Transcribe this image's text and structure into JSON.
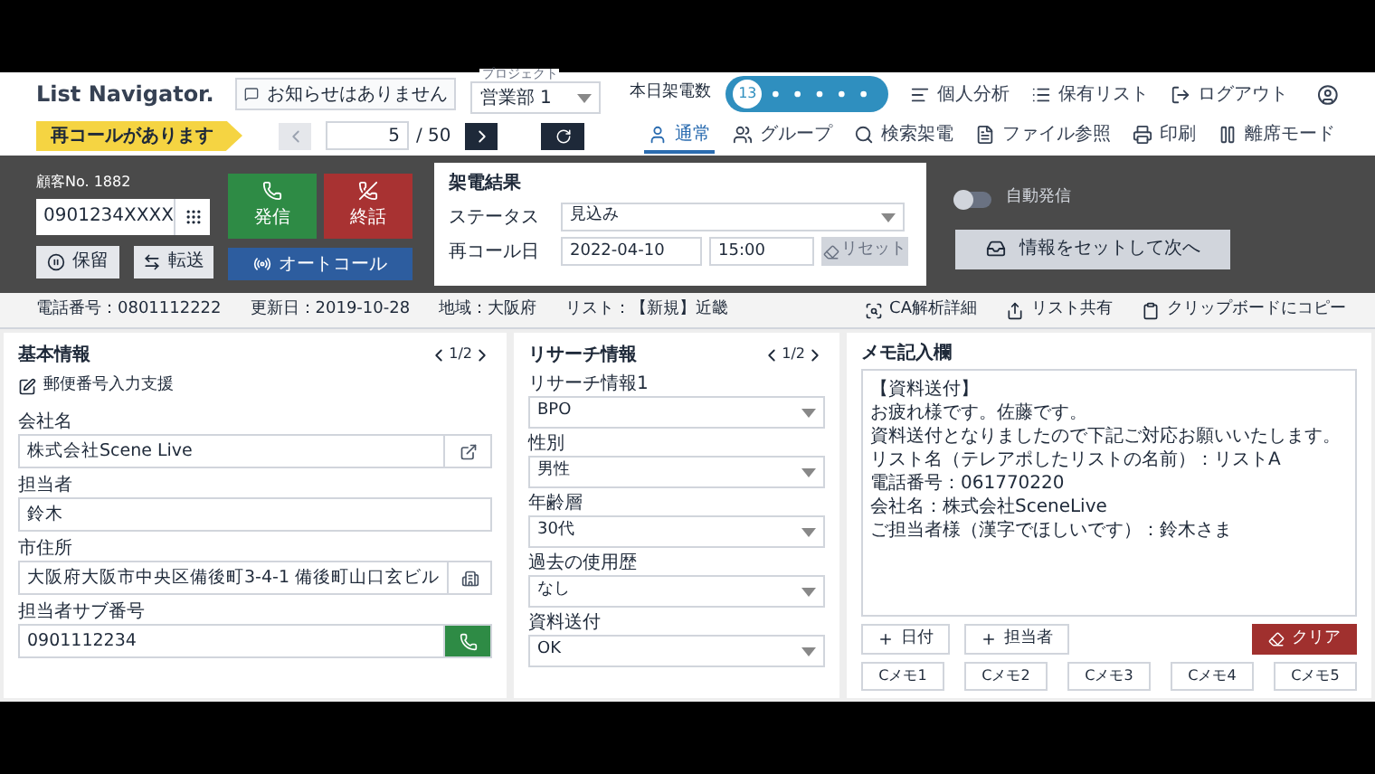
{
  "header": {
    "logo": "List Navigator.",
    "notice": "お知らせはありません",
    "project": {
      "label": "プロジェクト",
      "value": "営業部 1"
    },
    "call_count": {
      "label": "本日架電数",
      "count": "13"
    },
    "links": [
      {
        "label": "個人分析",
        "kind": "analysis"
      },
      {
        "label": "保有リスト",
        "kind": "list"
      },
      {
        "label": "ログアウト",
        "kind": "logout"
      }
    ]
  },
  "recall_notice": "再コールがあります",
  "pager": {
    "current": "5",
    "total": "/ 50",
    "prev_disabled": true,
    "next_disabled": false
  },
  "modes": [
    {
      "label": "通常",
      "kind": "user",
      "selected": true
    },
    {
      "label": "グループ",
      "kind": "group",
      "selected": false
    },
    {
      "label": "検索架電",
      "kind": "search",
      "selected": false
    },
    {
      "label": "ファイル参照",
      "kind": "file",
      "selected": false
    },
    {
      "label": "印刷",
      "kind": "print",
      "selected": false
    },
    {
      "label": "離席モード",
      "kind": "pause",
      "selected": false
    }
  ],
  "call_panel": {
    "customer_no": "顧客No. 1882",
    "phone": "0901234XXXX",
    "dial": "発信",
    "hangup": "終話",
    "hold": "保留",
    "transfer": "転送",
    "autocall": "オートコール"
  },
  "result": {
    "title": "架電結果",
    "status_label": "ステータス",
    "status": "見込み",
    "recall_label": "再コール日",
    "date": "2022-04-10",
    "time": "15:00",
    "reset": "リセット",
    "reset_disabled": true
  },
  "auto_dial": {
    "label": "自動発信",
    "on": false
  },
  "next_button": "情報をセットして次へ",
  "info_bar": {
    "items": [
      "電話番号：0801112222",
      "更新日：2019-10-28",
      "地域：大阪府",
      "リスト：【新規】近畿"
    ],
    "actions": [
      {
        "label": "CA解析詳細",
        "kind": "analysis"
      },
      {
        "label": "リスト共有",
        "kind": "share"
      },
      {
        "label": "クリップボードにコピー",
        "kind": "clipboard"
      }
    ]
  },
  "basic": {
    "title": "基本情報",
    "page": "1/2",
    "postal": "郵便番号入力支援",
    "fields": [
      {
        "label": "会社名",
        "value": "株式会社Scene Live",
        "kind": "link"
      },
      {
        "label": "担当者",
        "value": "鈴木",
        "kind": "plain"
      },
      {
        "label": "市住所",
        "value": "大阪府大阪市中央区備後町3-4-1 備後町山口玄ビル",
        "kind": "map"
      },
      {
        "label": "担当者サブ番号",
        "value": "0901112234",
        "kind": "call"
      }
    ]
  },
  "research": {
    "title": "リサーチ情報",
    "page": "1/2",
    "fields": [
      {
        "label": "リサーチ情報1",
        "value": "BPO"
      },
      {
        "label": "性別",
        "value": "男性"
      },
      {
        "label": "年齢層",
        "value": "30代"
      },
      {
        "label": "過去の使用歴",
        "value": "なし"
      },
      {
        "label": "資料送付",
        "value": "OK"
      }
    ]
  },
  "memo": {
    "title": "メモ記入欄",
    "lines": [
      "【資料送付】",
      "お疲れ様です。佐藤です。",
      "資料送付となりましたので下記ご対応お願いいたします。",
      "リスト名（テレアポしたリストの名前）：リストA",
      "電話番号：061770220",
      "会社名：株式会社SceneLive",
      "ご担当者様（漢字でほしいです）：鈴木さま"
    ],
    "add_buttons": [
      "日付",
      "担当者"
    ],
    "clear": "クリア",
    "templates": [
      "Cメモ1",
      "Cメモ2",
      "Cメモ3",
      "Cメモ4",
      "Cメモ5"
    ]
  }
}
